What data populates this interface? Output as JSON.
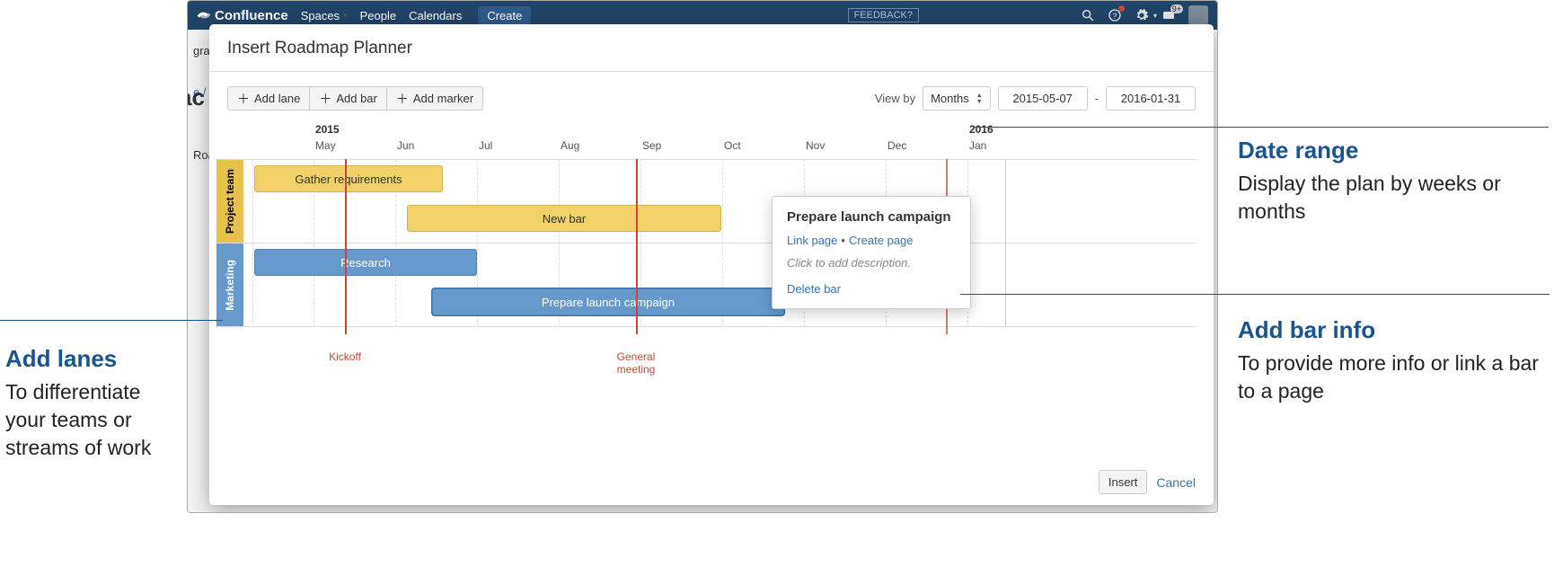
{
  "topnav": {
    "brand": "Confluence",
    "links": [
      "Spaces",
      "People",
      "Calendars"
    ],
    "create": "Create",
    "feedback": "FEEDBACK?",
    "notif_badge": "9+"
  },
  "page": {
    "breadcrumb_frag": "e /",
    "title_frag": "ac",
    "left_frag": "grap",
    "side_frag_top": "Road"
  },
  "modal": {
    "title": "Insert Roadmap Planner",
    "add_lane": "Add lane",
    "add_bar": "Add bar",
    "add_marker": "Add marker",
    "view_by": "View by",
    "view_by_value": "Months",
    "date_from": "2015-05-07",
    "date_sep": "-",
    "date_to": "2016-01-31",
    "insert": "Insert",
    "cancel": "Cancel"
  },
  "timeline": {
    "year_start": "2015",
    "year_end": "2016",
    "months": [
      "May",
      "Jun",
      "Jul",
      "Aug",
      "Sep",
      "Oct",
      "Nov",
      "Dec",
      "Jan"
    ]
  },
  "lanes": [
    {
      "id": "project",
      "label": "Project team",
      "color": "yellow"
    },
    {
      "id": "marketing",
      "label": "Marketing",
      "color": "blue"
    }
  ],
  "bars": {
    "gather": "Gather requirements",
    "newbar": "New bar",
    "research": "Research",
    "campaign": "Prepare launch campaign"
  },
  "markers": {
    "kickoff": "Kickoff",
    "meeting": "General\nmeeting"
  },
  "popover": {
    "title": "Prepare launch campaign",
    "link_page": "Link page",
    "create_page": "Create page",
    "desc": "Click to add description.",
    "delete": "Delete bar"
  },
  "callouts": {
    "date_range_h": "Date range",
    "date_range_p": "Display the plan by weeks or months",
    "bar_info_h": "Add bar info",
    "bar_info_p": "To provide more info or link a bar to a page",
    "add_lanes_h": "Add lanes",
    "add_lanes_p": "To differentiate your teams or streams of work"
  },
  "chart_data": {
    "type": "gantt",
    "view_by": "Months",
    "date_range": [
      "2015-05-07",
      "2016-01-31"
    ],
    "months": [
      "2015-05",
      "2015-06",
      "2015-07",
      "2015-08",
      "2015-09",
      "2015-10",
      "2015-11",
      "2015-12",
      "2016-01"
    ],
    "lanes": [
      {
        "name": "Project team",
        "bars": [
          {
            "label": "Gather requirements",
            "start": "2015-05-07",
            "end": "2015-06-20"
          },
          {
            "label": "New bar",
            "start": "2015-07-01",
            "end": "2015-10-15"
          }
        ]
      },
      {
        "name": "Marketing",
        "bars": [
          {
            "label": "Research",
            "start": "2015-05-07",
            "end": "2015-07-15"
          },
          {
            "label": "Prepare launch campaign",
            "start": "2015-07-20",
            "end": "2015-11-10"
          }
        ]
      }
    ],
    "markers": [
      {
        "label": "Kickoff",
        "date": "2015-06-05"
      },
      {
        "label": "General meeting",
        "date": "2015-09-05"
      }
    ]
  }
}
